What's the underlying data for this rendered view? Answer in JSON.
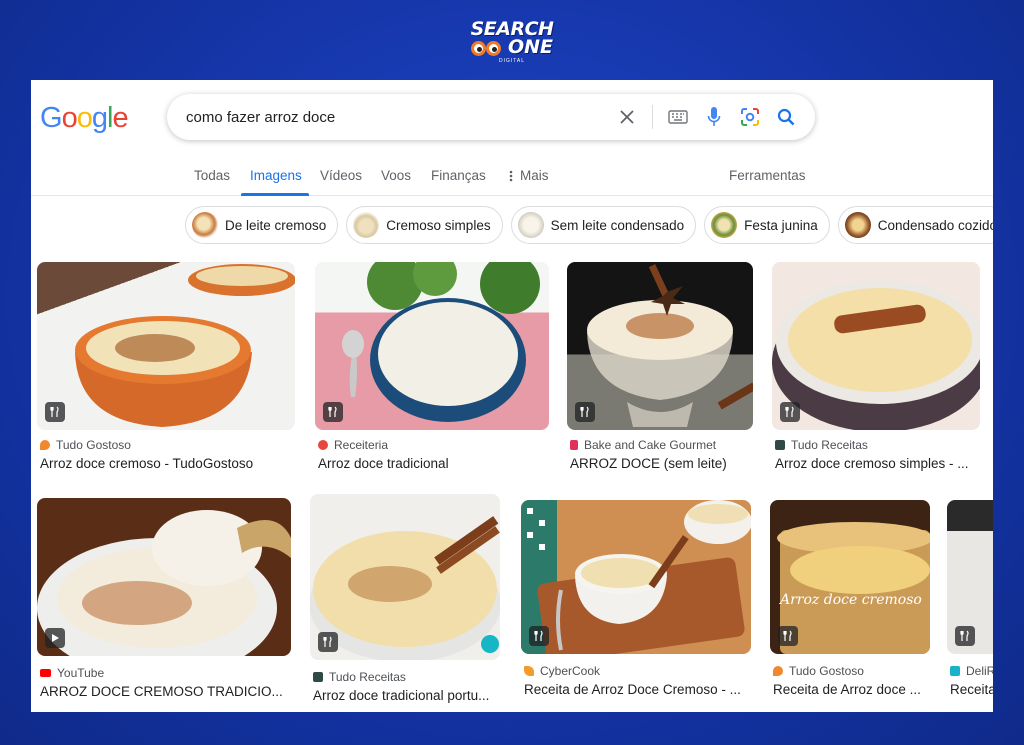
{
  "brand": {
    "line1": "SEARCH",
    "line2": "ONE",
    "line3": "DIGITAL"
  },
  "logo": "Google",
  "search": {
    "query": "como fazer arroz doce"
  },
  "tabs": [
    {
      "label": "Todas"
    },
    {
      "label": "Imagens"
    },
    {
      "label": "Vídeos"
    },
    {
      "label": "Voos"
    },
    {
      "label": "Finanças"
    },
    {
      "label": "Mais"
    },
    {
      "label": "Ferramentas"
    }
  ],
  "chips": [
    {
      "label": "De leite cremoso"
    },
    {
      "label": "Cremoso simples"
    },
    {
      "label": "Sem leite condensado"
    },
    {
      "label": "Festa junina"
    },
    {
      "label": "Condensado cozido"
    }
  ],
  "results": [
    {
      "source": "Tudo Gostoso",
      "title": "Arroz doce cremoso - TudoGostoso"
    },
    {
      "source": "Receiteria",
      "title": "Arroz doce tradicional"
    },
    {
      "source": "Bake and Cake Gourmet",
      "title": "ARROZ DOCE (sem leite)"
    },
    {
      "source": "Tudo Receitas",
      "title": "Arroz doce cremoso simples - ..."
    },
    {
      "source": "YouTube",
      "title": "ARROZ DOCE CREMOSO TRADICIO..."
    },
    {
      "source": "Tudo Receitas",
      "title": "Arroz doce tradicional portu..."
    },
    {
      "source": "CyberCook",
      "title": "Receita de Arroz Doce Cremoso - ..."
    },
    {
      "source": "Tudo Gostoso",
      "title": "Receita de Arroz doce ..."
    },
    {
      "source": "DeliR",
      "title": "Receita"
    }
  ],
  "image_overlay_text": "Arroz doce cremoso",
  "colors": {
    "accent": "#1a73e8",
    "background": "#1535a8"
  }
}
